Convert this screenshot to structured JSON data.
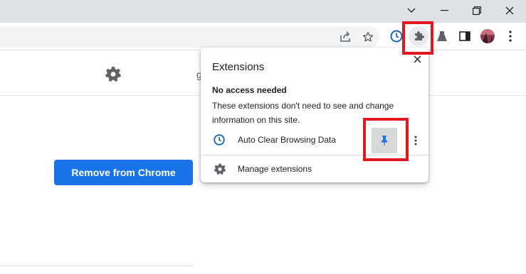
{
  "browser": {
    "window_controls": {
      "tab_search": "˅",
      "minimize": "—",
      "restore": "❐",
      "close": "✕"
    },
    "toolbar_icons": [
      "share-icon",
      "bookmark-star-icon",
      "auto-clear-extension-icon",
      "extensions-puzzle-icon",
      "labs-flask-icon",
      "side-panel-icon",
      "profile-avatar",
      "menu-kebab-icon"
    ]
  },
  "page": {
    "header_fragment": "g",
    "remove_button": "Remove from Chrome"
  },
  "popup": {
    "title": "Extensions",
    "section_title": "No access needed",
    "section_desc": "These extensions don't need to see and change information on this site.",
    "extension": {
      "name": "Auto Clear Browsing Data"
    },
    "manage_label": "Manage extensions"
  },
  "colors": {
    "accent": "#1a73e8",
    "highlight": "#e3151f",
    "titlebar": "#dee1e6"
  }
}
